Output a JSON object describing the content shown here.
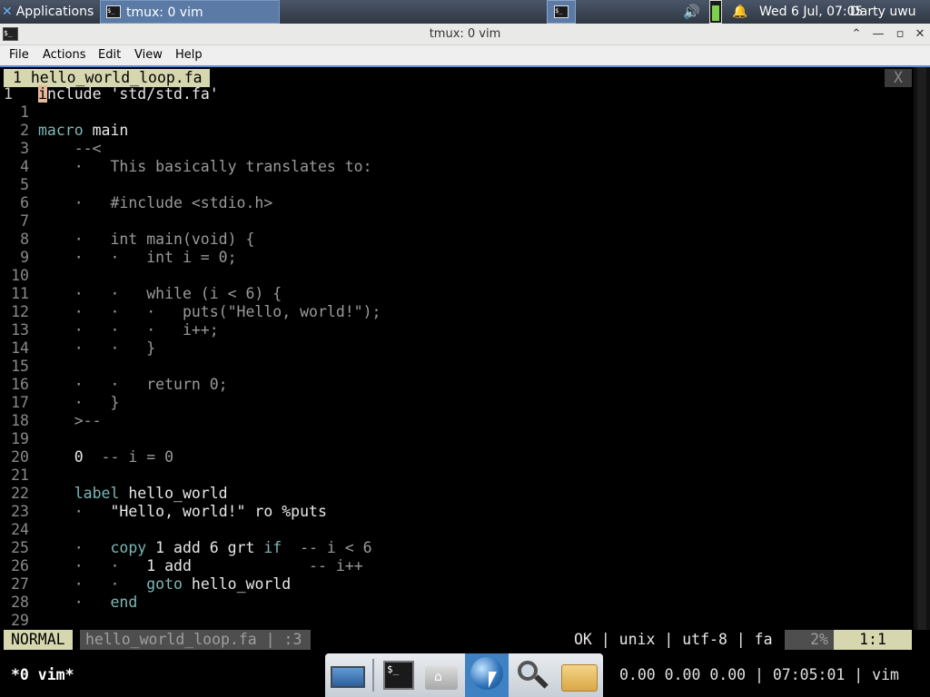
{
  "panel": {
    "applications": "Applications",
    "task_title": "tmux: 0 vim",
    "clock": "Wed  6 Jul, 07:05",
    "user": "Darty uwu"
  },
  "window": {
    "title": "tmux: 0 vim",
    "menu": [
      "File",
      "Actions",
      "Edit",
      "View",
      "Help"
    ]
  },
  "vim": {
    "tab_label": "1 hello_world_loop.fa",
    "tab_close": "X",
    "lines": [
      {
        "num": "1",
        "current": true
      },
      {
        "num": "1"
      },
      {
        "num": "2"
      },
      {
        "num": "3"
      },
      {
        "num": "4"
      },
      {
        "num": "5"
      },
      {
        "num": "6"
      },
      {
        "num": "7"
      },
      {
        "num": "8"
      },
      {
        "num": "9"
      },
      {
        "num": "10"
      },
      {
        "num": "11"
      },
      {
        "num": "12"
      },
      {
        "num": "13"
      },
      {
        "num": "14"
      },
      {
        "num": "15"
      },
      {
        "num": "16"
      },
      {
        "num": "17"
      },
      {
        "num": "18"
      },
      {
        "num": "19"
      },
      {
        "num": "20"
      },
      {
        "num": "21"
      },
      {
        "num": "22"
      },
      {
        "num": "23"
      },
      {
        "num": "24"
      },
      {
        "num": "25"
      },
      {
        "num": "26"
      },
      {
        "num": "27"
      },
      {
        "num": "28"
      },
      {
        "num": "29"
      }
    ],
    "code": {
      "l0_cursor": "i",
      "l0_rest": "nclude 'std/std.fa'",
      "l2_kw": "macro",
      "l2_id": "main",
      "l3": "    --<",
      "l4": "    ·   This basically translates to:",
      "l6": "    ·   #include <stdio.h>",
      "l8": "    ·   int main(void) {",
      "l9": "    ·   ·   int i = 0;",
      "l11": "    ·   ·   while (i < 6) {",
      "l12": "    ·   ·   ·   puts(\"Hello, world!\");",
      "l13": "    ·   ·   ·   i++;",
      "l14": "    ·   ·   }",
      "l16": "    ·   ·   return 0;",
      "l17": "    ·   }",
      "l18": "    >--",
      "l20_num": "    0",
      "l20_cm": "  -- i = 0",
      "l22_kw": "    label",
      "l22_id": " hello_world",
      "l23_dot": "    ·   ",
      "l23_id": "\"Hello, world!\" ro %puts",
      "l25_dot": "    ·   ",
      "l25_kw": "copy",
      "l25_id": " 1 add 6 grt ",
      "l25_kw2": "if",
      "l25_cm": "  -- i < 6",
      "l26_dot": "    ·   ·   ",
      "l26_id": "1 add",
      "l26_cm": "             -- i++",
      "l27_dot": "    ·   ·   ",
      "l27_kw": "goto",
      "l27_id": " hello_world",
      "l28_dot": "    ·   ",
      "l28_kw": "end"
    },
    "status": {
      "mode": "NORMAL",
      "file": "hello_world_loop.fa | :3",
      "right": "OK | unix | utf-8 | fa",
      "percent": "2%",
      "position": "1:1"
    }
  },
  "tmux": {
    "left": "*0 vim*",
    "right": "0.00 0.00 0.00 | 07:05:01 | vim"
  },
  "dock": [
    "desktop-icon",
    "terminal-icon",
    "home-folder-icon",
    "web-browser-icon",
    "search-icon",
    "file-manager-icon"
  ]
}
